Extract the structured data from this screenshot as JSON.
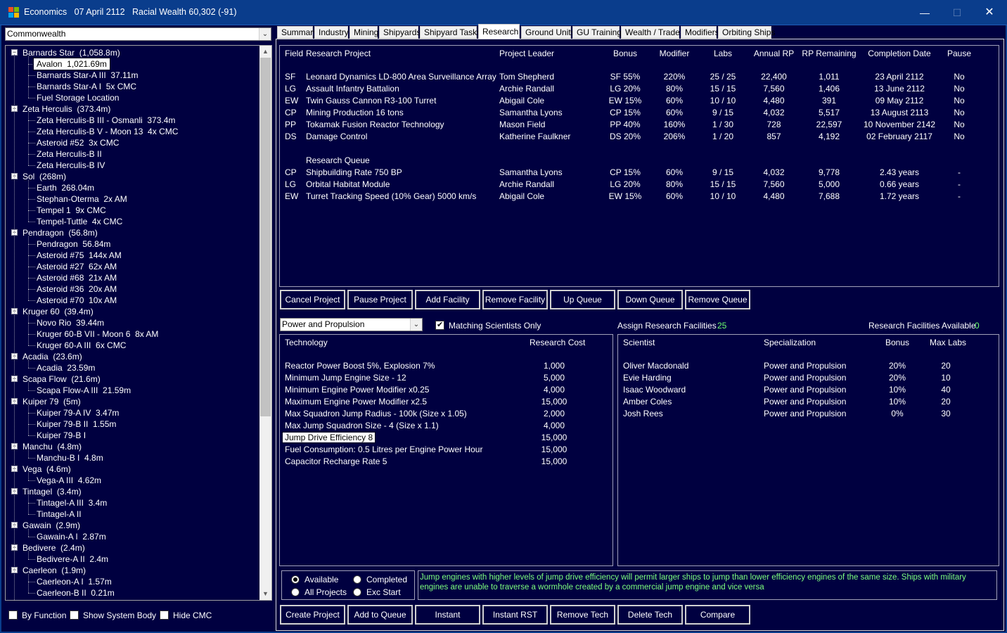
{
  "window": {
    "title": "Economics",
    "date": "07 April 2112",
    "wealth": "Racial Wealth 60,302 (-91)",
    "min_glyph": "—",
    "max_glyph": "☐",
    "close_glyph": "✕"
  },
  "empire_select": {
    "value": "Commonwealth",
    "arrow": "⌄"
  },
  "tree": [
    {
      "label": "Barnards Star  (1,058.8m)",
      "level": 0,
      "expander": "−"
    },
    {
      "label": "Avalon  1,021.69m",
      "level": 1,
      "selected": true
    },
    {
      "label": "Barnards Star-A III  37.11m",
      "level": 1
    },
    {
      "label": "Barnards Star-A I  5x CMC",
      "level": 1
    },
    {
      "label": "Fuel Storage Location",
      "level": 1
    },
    {
      "label": "Zeta Herculis  (373.4m)",
      "level": 0,
      "expander": "−"
    },
    {
      "label": "Zeta Herculis-B III - Osmanli  373.4m",
      "level": 1
    },
    {
      "label": "Zeta Herculis-B V - Moon 13  4x CMC",
      "level": 1
    },
    {
      "label": "Asteroid #52  3x CMC",
      "level": 1
    },
    {
      "label": "Zeta Herculis-B II",
      "level": 1
    },
    {
      "label": "Zeta Herculis-B IV",
      "level": 1
    },
    {
      "label": "Sol  (268m)",
      "level": 0,
      "expander": "−"
    },
    {
      "label": "Earth  268.04m",
      "level": 1
    },
    {
      "label": "Stephan-Oterma  2x AM",
      "level": 1
    },
    {
      "label": "Tempel 1  9x CMC",
      "level": 1
    },
    {
      "label": "Tempel-Tuttle  4x CMC",
      "level": 1
    },
    {
      "label": "Pendragon  (56.8m)",
      "level": 0,
      "expander": "−"
    },
    {
      "label": "Pendragon  56.84m",
      "level": 1
    },
    {
      "label": "Asteroid #75  144x AM",
      "level": 1
    },
    {
      "label": "Asteroid #27  62x AM",
      "level": 1
    },
    {
      "label": "Asteroid #68  21x AM",
      "level": 1
    },
    {
      "label": "Asteroid #36  20x AM",
      "level": 1
    },
    {
      "label": "Asteroid #70  10x AM",
      "level": 1
    },
    {
      "label": "Kruger 60  (39.4m)",
      "level": 0,
      "expander": "−"
    },
    {
      "label": "Novo Rio  39.44m",
      "level": 1
    },
    {
      "label": "Kruger 60-B VII - Moon 6  8x AM",
      "level": 1
    },
    {
      "label": "Kruger 60-A III  6x CMC",
      "level": 1
    },
    {
      "label": "Acadia  (23.6m)",
      "level": 0,
      "expander": "−"
    },
    {
      "label": "Acadia  23.59m",
      "level": 1
    },
    {
      "label": "Scapa Flow  (21.6m)",
      "level": 0,
      "expander": "−"
    },
    {
      "label": "Scapa Flow-A III  21.59m",
      "level": 1
    },
    {
      "label": "Kuiper 79  (5m)",
      "level": 0,
      "expander": "−"
    },
    {
      "label": "Kuiper 79-A IV  3.47m",
      "level": 1
    },
    {
      "label": "Kuiper 79-B II  1.55m",
      "level": 1
    },
    {
      "label": "Kuiper 79-B I",
      "level": 1
    },
    {
      "label": "Manchu  (4.8m)",
      "level": 0,
      "expander": "−"
    },
    {
      "label": "Manchu-B I  4.8m",
      "level": 1
    },
    {
      "label": "Vega  (4.6m)",
      "level": 0,
      "expander": "−"
    },
    {
      "label": "Vega-A III  4.62m",
      "level": 1
    },
    {
      "label": "Tintagel  (3.4m)",
      "level": 0,
      "expander": "−"
    },
    {
      "label": "Tintagel-A III  3.4m",
      "level": 1
    },
    {
      "label": "Tintagel-A II",
      "level": 1
    },
    {
      "label": "Gawain  (2.9m)",
      "level": 0,
      "expander": "−"
    },
    {
      "label": "Gawain-A I  2.87m",
      "level": 1
    },
    {
      "label": "Bedivere  (2.4m)",
      "level": 0,
      "expander": "−"
    },
    {
      "label": "Bedivere-A II  2.4m",
      "level": 1
    },
    {
      "label": "Caerleon  (1.9m)",
      "level": 0,
      "expander": "−"
    },
    {
      "label": "Caerleon-A I  1.57m",
      "level": 1
    },
    {
      "label": "Caerleon-B II  0.21m",
      "level": 1
    }
  ],
  "tree_scroll": {
    "up": "▲",
    "down": "▼"
  },
  "left_options": [
    {
      "label": "By Function",
      "checked": false
    },
    {
      "label": "Show System Body",
      "checked": false
    },
    {
      "label": "Hide CMC",
      "checked": false
    }
  ],
  "tabs": [
    {
      "label": "Summary"
    },
    {
      "label": "Industry"
    },
    {
      "label": "Mining"
    },
    {
      "label": "Shipyards"
    },
    {
      "label": "Shipyard Tasks"
    },
    {
      "label": "Research",
      "active": true
    },
    {
      "label": "Ground Units"
    },
    {
      "label": "GU Training"
    },
    {
      "label": "Wealth / Trade"
    },
    {
      "label": "Modifiers"
    },
    {
      "label": "Orbiting Ships"
    }
  ],
  "projects": {
    "headers": [
      "Field",
      "Research Project",
      "Project Leader",
      "Bonus",
      "Modifier",
      "Labs",
      "Annual RP",
      "RP Remaining",
      "Completion Date",
      "Pause"
    ],
    "rows": [
      [
        "SF",
        "Leonard Dynamics LD-800 Area Surveillance Array",
        "Tom Shepherd",
        "SF 55%",
        "220%",
        "25 / 25",
        "22,400",
        "1,011",
        "23 April 2112",
        "No"
      ],
      [
        "LG",
        "Assault Infantry Battalion",
        "Archie Randall",
        "LG 20%",
        "80%",
        "15 / 15",
        "7,560",
        "1,406",
        "13 June 2112",
        "No"
      ],
      [
        "EW",
        "Twin Gauss Cannon R3-100 Turret",
        "Abigail Cole",
        "EW 15%",
        "60%",
        "10 / 10",
        "4,480",
        "391",
        "09 May 2112",
        "No"
      ],
      [
        "CP",
        "Mining Production 16 tons",
        "Samantha Lyons",
        "CP 15%",
        "60%",
        "9 / 15",
        "4,032",
        "5,517",
        "13 August 2113",
        "No"
      ],
      [
        "PP",
        "Tokamak Fusion Reactor Technology",
        "Mason Field",
        "PP 40%",
        "160%",
        "1 / 30",
        "728",
        "22,597",
        "10 November 2142",
        "No"
      ],
      [
        "DS",
        "Damage Control",
        "Katherine Faulkner",
        "DS 20%",
        "206%",
        "1 / 20",
        "857",
        "4,192",
        "02 February 2117",
        "No"
      ]
    ],
    "queue_title": "Research Queue",
    "queue": [
      [
        "CP",
        "Shipbuilding Rate 750 BP",
        "Samantha Lyons",
        "CP 15%",
        "60%",
        "9 / 15",
        "4,032",
        "9,778",
        "2.43 years",
        "-"
      ],
      [
        "LG",
        "Orbital Habitat Module",
        "Archie Randall",
        "LG 20%",
        "80%",
        "15 / 15",
        "7,560",
        "5,000",
        "0.66 years",
        "-"
      ],
      [
        "EW",
        "Turret Tracking Speed (10% Gear) 5000 km/s",
        "Abigail Cole",
        "EW 15%",
        "60%",
        "10 / 10",
        "4,480",
        "7,688",
        "1.72 years",
        "-"
      ]
    ]
  },
  "project_buttons": [
    "Cancel Project",
    "Pause Project",
    "Add Facility",
    "Remove Facility",
    "Up Queue",
    "Down Queue",
    "Remove Queue"
  ],
  "field_select": {
    "value": "Power and Propulsion",
    "arrow": "⌄"
  },
  "matching_scientists": {
    "label": "Matching Scientists Only",
    "checked": true
  },
  "assign": {
    "label": "Assign Research Facilities",
    "value": "25"
  },
  "available": {
    "label": "Research Facilities Available",
    "value": "0"
  },
  "technologies": {
    "headers": [
      "Technology",
      "Research Cost"
    ],
    "rows": [
      [
        "Reactor Power Boost 5%, Explosion 7%",
        "1,000"
      ],
      [
        "Minimum Jump Engine Size - 12",
        "5,000"
      ],
      [
        "Minimum Engine Power Modifier x0.25",
        "4,000"
      ],
      [
        "Maximum Engine Power Modifier x2.5",
        "15,000"
      ],
      [
        "Max Squadron Jump Radius - 100k (Size x 1.05)",
        "2,000"
      ],
      [
        "Max Jump Squadron Size - 4 (Size x 1.1)",
        "4,000"
      ],
      [
        "Jump Drive Efficiency 8",
        "15,000"
      ],
      [
        "Fuel Consumption: 0.5 Litres per Engine Power Hour",
        "15,000"
      ],
      [
        "Capacitor Recharge Rate 5",
        "15,000"
      ]
    ],
    "selected_index": 6
  },
  "scientists": {
    "headers": [
      "Scientist",
      "Specialization",
      "Bonus",
      "Max Labs"
    ],
    "rows": [
      [
        "Oliver Macdonald",
        "Power and Propulsion",
        "20%",
        "20"
      ],
      [
        "Evie Harding",
        "Power and Propulsion",
        "20%",
        "10"
      ],
      [
        "Isaac Woodward",
        "Power and Propulsion",
        "10%",
        "40"
      ],
      [
        "Amber Coles",
        "Power and Propulsion",
        "10%",
        "20"
      ],
      [
        "Josh Rees",
        "Power and Propulsion",
        "0%",
        "30"
      ]
    ]
  },
  "filters": [
    {
      "label": "Available",
      "checked": true
    },
    {
      "label": "Completed",
      "checked": false
    },
    {
      "label": "All Projects",
      "checked": false
    },
    {
      "label": "Exc Start",
      "checked": false
    }
  ],
  "description": "Jump engines with higher levels of jump drive efficiency will permit larger ships to jump than lower efficiency engines of the same size. Ships with military engines are unable to traverse a wormhole created by a commercial jump engine and vice versa",
  "bottom_buttons": [
    "Create Project",
    "Add to Queue",
    "Instant",
    "Instant RST",
    "Remove Tech",
    "Delete Tech",
    "Compare"
  ]
}
